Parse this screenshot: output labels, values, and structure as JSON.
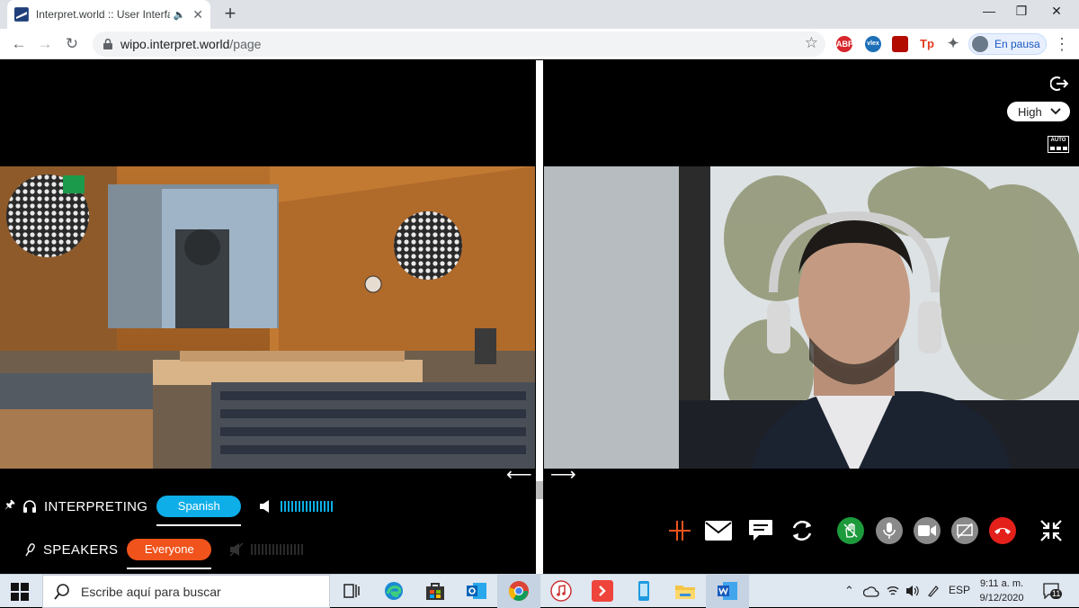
{
  "browser": {
    "tab_title": "Interpret.world :: User Interfa",
    "new_tab_label": "+",
    "url_host": "wipo.interpret.world",
    "url_path": "/page",
    "profile_label": "En pausa",
    "extensions": [
      "ABP",
      "vlex",
      "pdf",
      "Tp",
      "puzzle"
    ]
  },
  "right_panel": {
    "quality_value": "High",
    "auto_label": "AUTO"
  },
  "controls": {
    "interpreting_label": "INTERPRETING",
    "language_selected": "Spanish",
    "speakers_label": "SPEAKERS",
    "speakers_selected": "Everyone"
  },
  "toolbar": {
    "tools": [
      "split-icon",
      "mail-icon",
      "chat-icon",
      "refresh-icon",
      "raise-hand-icon",
      "microphone-icon",
      "camera-icon",
      "slides-off-icon",
      "hangup-icon",
      "collapse-icon"
    ]
  },
  "taskbar": {
    "search_placeholder": "Escribe aquí para buscar",
    "language": "ESP",
    "time": "9:11 a. m.",
    "date": "9/12/2020",
    "notification_count": "11"
  },
  "colors": {
    "accent_blue": "#0eaee8",
    "accent_orange": "#f0531c",
    "hand_green": "#1d9a3c",
    "hangup_red": "#e4201b"
  }
}
